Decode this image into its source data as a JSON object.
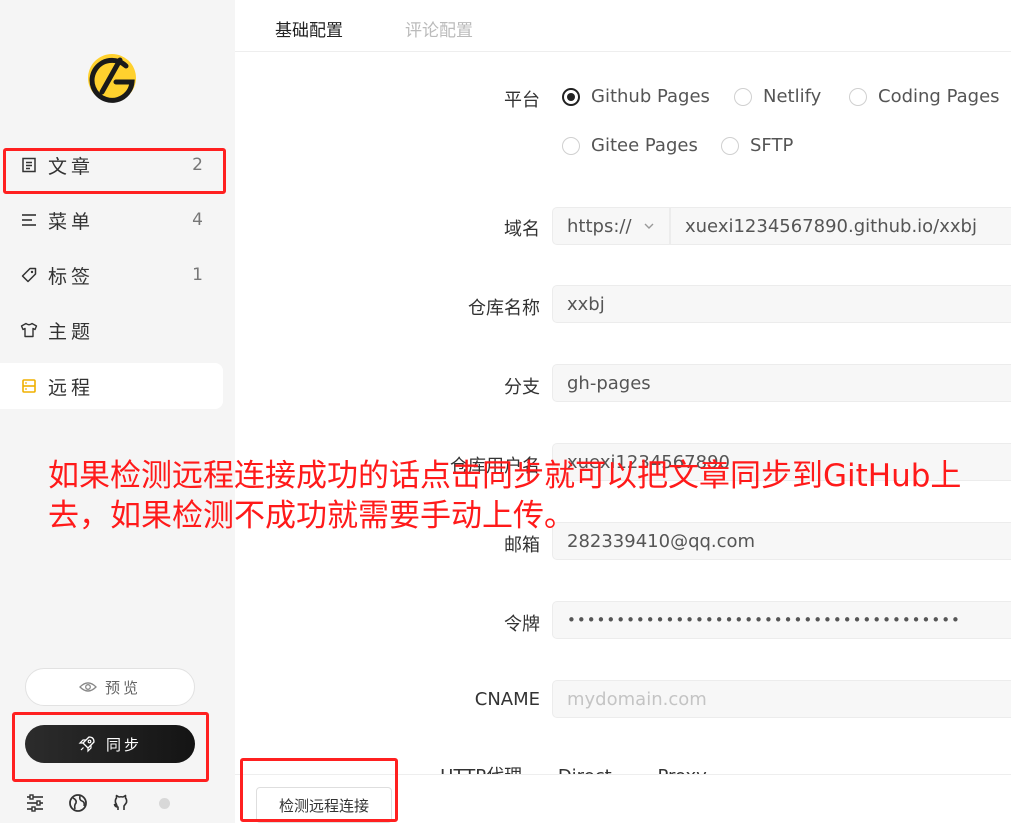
{
  "sidebar": {
    "items": [
      {
        "label": "文章",
        "count": "2",
        "icon": "article-icon"
      },
      {
        "label": "菜单",
        "count": "4",
        "icon": "menu-icon"
      },
      {
        "label": "标签",
        "count": "1",
        "icon": "tag-icon"
      },
      {
        "label": "主题",
        "count": "",
        "icon": "shirt-icon"
      },
      {
        "label": "远程",
        "count": "",
        "icon": "remote-icon"
      }
    ],
    "active_item": "远程",
    "preview_label": "预览",
    "sync_label": "同步",
    "bottom_icons": [
      "settings-icon",
      "globe-icon",
      "github-icon",
      "status-dot"
    ]
  },
  "tabs": [
    {
      "label": "基础配置",
      "active": true
    },
    {
      "label": "评论配置",
      "active": false
    }
  ],
  "form": {
    "platform": {
      "label": "平台",
      "options": [
        "Github Pages",
        "Netlify",
        "Coding Pages",
        "Gitee Pages",
        "SFTP"
      ],
      "selected": "Github Pages"
    },
    "domain": {
      "label": "域名",
      "protocol": "https://",
      "value": "xuexi1234567890.github.io/xxbj"
    },
    "repo": {
      "label": "仓库名称",
      "value": "xxbj"
    },
    "branch": {
      "label": "分支",
      "value": "gh-pages"
    },
    "username": {
      "label": "仓库用户名",
      "value": "xuexi1234567890"
    },
    "email": {
      "label": "邮箱",
      "value": "282339410@qq.com"
    },
    "token": {
      "label": "令牌",
      "value": "••••••••••••••••••••••••••••••••••••••••"
    },
    "cname": {
      "label": "CNAME",
      "placeholder": "mydomain.com"
    },
    "proxy": {
      "label": "HTTP代理",
      "options": [
        "Direct",
        "Proxy"
      ]
    }
  },
  "check_button_label": "检测远程连接",
  "annotation": {
    "text": "如果检测远程连接成功的话点击同步就可以把文章同步到GitHub上去，如果检测不成功就需要手动上传。",
    "color": "#ff1a1a"
  },
  "colors": {
    "accent": "#f0b100",
    "sidebar_bg": "#f5f5f5",
    "sync_bg": "#1e1e1e"
  }
}
